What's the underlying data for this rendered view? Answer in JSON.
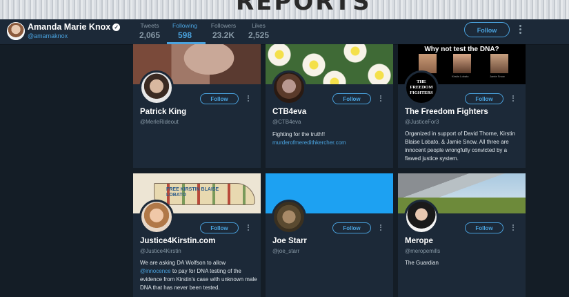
{
  "banner": {
    "text": "REPORTS"
  },
  "profile": {
    "name": "Amanda Marie Knox",
    "handle": "@amamaknox",
    "follow_label": "Follow"
  },
  "stats": [
    {
      "label": "Tweets",
      "value": "2,065"
    },
    {
      "label": "Following",
      "value": "598"
    },
    {
      "label": "Followers",
      "value": "23.2K"
    },
    {
      "label": "Likes",
      "value": "2,525"
    }
  ],
  "cards": [
    {
      "name": "Patrick King",
      "handle": "@MerleRideout",
      "bio": "",
      "follow_label": "Follow"
    },
    {
      "name": "CTB4eva",
      "handle": "@CTB4eva",
      "bio": "Fighting for the truth!!",
      "link": "murderofmeredithkercher.com",
      "follow_label": "Follow"
    },
    {
      "name": "The Freedom Fighters",
      "handle": "@JusticeFor3",
      "bio": "Organized in support of David Thorne, Kirstin Blaise Lobato, & Jamie Snow. All three are innocent people wrongfully convicted by a flawed justice system.",
      "follow_label": "Follow",
      "header_title": "Why not test the DNA?",
      "header_captions": [
        "Kirstin Lobato",
        "Jamie Snow"
      ],
      "avatar_text": "THE FREEDOM FIGHTERS"
    },
    {
      "name": "Justice4Kirstin.com",
      "handle": "@Justice4Kirstin",
      "bio_before": "We are asking DA Wolfson to allow ",
      "bio_link": "@innocence",
      "bio_after": " to pay for DNA testing of the evidence from Kirstin's case with unknown male DNA that has never been tested.",
      "follow_label": "Follow",
      "header_text": "FREE KIRSTIN BLAISE LOBATO"
    },
    {
      "name": "Joe Starr",
      "handle": "@joe_starr",
      "bio": "",
      "follow_label": "Follow"
    },
    {
      "name": "Merope",
      "handle": "@meropemills",
      "bio": "The Guardian",
      "follow_label": "Follow"
    }
  ],
  "colors": {
    "background": "#141d26",
    "card": "#1c2938",
    "accent": "#4aa3df",
    "muted": "#8899a6"
  }
}
